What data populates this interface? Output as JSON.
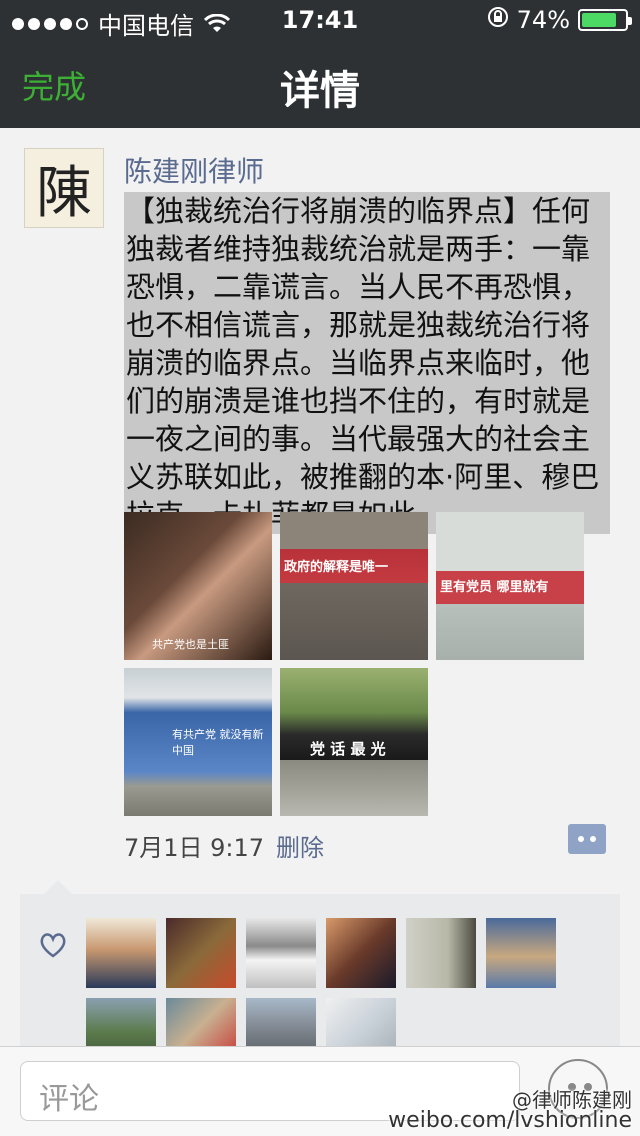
{
  "status_bar": {
    "carrier": "中国电信",
    "time": "17:41",
    "battery": "74%",
    "battery_level": 0.74
  },
  "nav": {
    "done_label": "完成",
    "title": "详情"
  },
  "post": {
    "author": "陈建刚律师",
    "avatar_char": "陳",
    "text": "【独裁统治行将崩溃的临界点】任何独裁者维持独裁统治就是两手：一靠恐惧，二靠谎言。当人民不再恐惧，也不相信谎言，那就是独裁统治行将崩溃的临界点。当临界点来临时，他们的崩溃是谁也挡不住的，有时就是一夜之间的事。当代最强大的社会主义苏联如此，被推翻的本·阿里、穆巴拉克、卡扎菲都是如此。",
    "images": [
      {
        "caption": "共产党也是土匪"
      },
      {
        "caption": "政府的解释是唯一"
      },
      {
        "caption": "里有党员 哪里就有"
      },
      {
        "caption": "有共产党 就没有新中国"
      },
      {
        "caption": "党 话 最 光"
      }
    ],
    "timestamp": "7月1日 9:17",
    "delete_label": "删除"
  },
  "likes": {
    "count_rows": 2
  },
  "comment_bar": {
    "placeholder": "评论"
  },
  "watermark": {
    "line1": "@律师陈建刚",
    "line2": "weibo.com/lvshionline"
  },
  "colors": {
    "nav_bg": "#2e3133",
    "done_green": "#3cb034",
    "name_blue": "#5a6b8f",
    "selection_gray": "#c8c8c8",
    "battery_green": "#4cd964"
  }
}
